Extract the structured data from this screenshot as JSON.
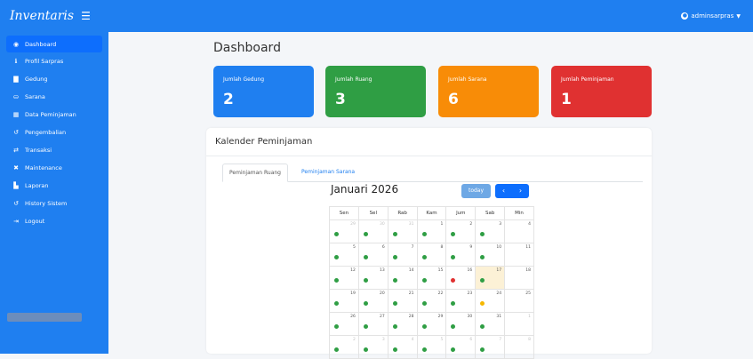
{
  "app": {
    "brand": "Inventaris",
    "user": "adminsarpras"
  },
  "icons": {
    "menu": "hamburger-icon",
    "user": "user-circle-icon",
    "dropdown": "caret-down-icon",
    "prev": "chevron-left-icon",
    "next": "chevron-right-icon"
  },
  "colors": {
    "primary": "#1f7ff0",
    "card_gedung": "#1f7ff0",
    "card_ruang": "#2f9e44",
    "card_sarana": "#f88c07",
    "card_peminjaman": "#e03131",
    "event_green": "#2f9e44",
    "event_red": "#e03131",
    "event_yellow": "#f5b700"
  },
  "sidebar": {
    "items": [
      {
        "label": "Dashboard",
        "icon": "dashboard-icon",
        "glyph": "◉",
        "active": true
      },
      {
        "label": "Profil Sarpras",
        "icon": "info-icon",
        "glyph": "ℹ",
        "active": false
      },
      {
        "label": "Gedung",
        "icon": "building-icon",
        "glyph": "▇",
        "active": false
      },
      {
        "label": "Sarana",
        "icon": "box-icon",
        "glyph": "⛀",
        "active": false
      },
      {
        "label": "Data Peminjaman",
        "icon": "calendar-icon",
        "glyph": "▦",
        "active": false
      },
      {
        "label": "Pengembalian",
        "icon": "undo-icon",
        "glyph": "↺",
        "active": false
      },
      {
        "label": "Transaksi",
        "icon": "exchange-icon",
        "glyph": "⇄",
        "active": false
      },
      {
        "label": "Maintenance",
        "icon": "tools-icon",
        "glyph": "✖",
        "active": false
      },
      {
        "label": "Laporan",
        "icon": "file-icon",
        "glyph": "▙",
        "active": false
      },
      {
        "label": "History Sistem",
        "icon": "history-icon",
        "glyph": "↺",
        "active": false
      },
      {
        "label": "Logout",
        "icon": "logout-icon",
        "glyph": "⇥",
        "active": false
      }
    ]
  },
  "page": {
    "title": "Dashboard"
  },
  "stats": [
    {
      "label": "Jumlah Gedung",
      "value": "2"
    },
    {
      "label": "Jumlah Ruang",
      "value": "3"
    },
    {
      "label": "Jumlah Sarana",
      "value": "6"
    },
    {
      "label": "Jumlah Peminjaman",
      "value": "1"
    }
  ],
  "calendar": {
    "panel_title": "Kalender Peminjaman",
    "tabs": [
      "Peminjaman Ruang",
      "Peminjaman Sarana"
    ],
    "active_tab": "Peminjaman Ruang",
    "month_title": "Januari 2026",
    "today_label": "today",
    "prev_label": "‹",
    "next_label": "›",
    "weekdays": [
      "Sen",
      "Sel",
      "Rab",
      "Kam",
      "Jum",
      "Sab",
      "Min"
    ],
    "weeks": [
      [
        {
          "day": "29",
          "other": true,
          "dot": "green"
        },
        {
          "day": "30",
          "other": true,
          "dot": "green"
        },
        {
          "day": "31",
          "other": true,
          "dot": "green"
        },
        {
          "day": "1",
          "other": false,
          "dot": "green"
        },
        {
          "day": "2",
          "other": false,
          "dot": "green"
        },
        {
          "day": "3",
          "other": false,
          "dot": "green"
        },
        {
          "day": "4",
          "other": false,
          "dot": ""
        }
      ],
      [
        {
          "day": "5",
          "other": false,
          "dot": "green"
        },
        {
          "day": "6",
          "other": false,
          "dot": "green"
        },
        {
          "day": "7",
          "other": false,
          "dot": "green"
        },
        {
          "day": "8",
          "other": false,
          "dot": "green"
        },
        {
          "day": "9",
          "other": false,
          "dot": "green"
        },
        {
          "day": "10",
          "other": false,
          "dot": "green"
        },
        {
          "day": "11",
          "other": false,
          "dot": ""
        }
      ],
      [
        {
          "day": "12",
          "other": false,
          "dot": "green"
        },
        {
          "day": "13",
          "other": false,
          "dot": "green"
        },
        {
          "day": "14",
          "other": false,
          "dot": "green"
        },
        {
          "day": "15",
          "other": false,
          "dot": "green"
        },
        {
          "day": "16",
          "other": false,
          "dot": "red"
        },
        {
          "day": "17",
          "other": false,
          "dot": "green",
          "today": true
        },
        {
          "day": "18",
          "other": false,
          "dot": ""
        }
      ],
      [
        {
          "day": "19",
          "other": false,
          "dot": "green"
        },
        {
          "day": "20",
          "other": false,
          "dot": "green"
        },
        {
          "day": "21",
          "other": false,
          "dot": "green"
        },
        {
          "day": "22",
          "other": false,
          "dot": "green"
        },
        {
          "day": "23",
          "other": false,
          "dot": "green"
        },
        {
          "day": "24",
          "other": false,
          "dot": "yellow"
        },
        {
          "day": "25",
          "other": false,
          "dot": ""
        }
      ],
      [
        {
          "day": "26",
          "other": false,
          "dot": "green"
        },
        {
          "day": "27",
          "other": false,
          "dot": "green"
        },
        {
          "day": "28",
          "other": false,
          "dot": "green"
        },
        {
          "day": "29",
          "other": false,
          "dot": "green"
        },
        {
          "day": "30",
          "other": false,
          "dot": "green"
        },
        {
          "day": "31",
          "other": false,
          "dot": "green"
        },
        {
          "day": "1",
          "other": true,
          "dot": ""
        }
      ],
      [
        {
          "day": "2",
          "other": true,
          "dot": "green"
        },
        {
          "day": "3",
          "other": true,
          "dot": "green"
        },
        {
          "day": "4",
          "other": true,
          "dot": "green"
        },
        {
          "day": "5",
          "other": true,
          "dot": "green"
        },
        {
          "day": "6",
          "other": true,
          "dot": "green"
        },
        {
          "day": "7",
          "other": true,
          "dot": "green"
        },
        {
          "day": "8",
          "other": true,
          "dot": ""
        }
      ]
    ]
  }
}
